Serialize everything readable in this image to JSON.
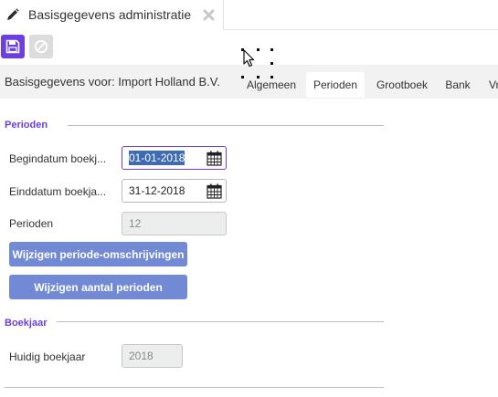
{
  "document_tab": {
    "title": "Basisgegevens administratie",
    "icon": "pencil-icon",
    "close_icon": "close-x-icon"
  },
  "toolbar": {
    "save_icon": "floppy-disk-icon",
    "cancel_icon": "cancel-circle-icon",
    "accent_color": "#6b3fe0"
  },
  "infobar": {
    "label": "Basisgegevens voor: Import Holland B.V."
  },
  "tabs": [
    {
      "label": "Algemeen",
      "active": false
    },
    {
      "label": "Perioden",
      "active": true
    },
    {
      "label": "Grootboek",
      "active": false
    },
    {
      "label": "Bank",
      "active": false
    },
    {
      "label": "Vr",
      "active": false
    }
  ],
  "sections": {
    "perioden": {
      "title": "Perioden",
      "begindatum_label": "Begindatum boekj...",
      "begindatum_value": "01-01-2018",
      "einddatum_label": "Einddatum boekja...",
      "einddatum_value": "31-12-2018",
      "perioden_label": "Perioden",
      "perioden_value": "12",
      "btn_omschrijvingen": "Wijzigen periode-omschrijvingen",
      "btn_aantal": "Wijzigen aantal perioden"
    },
    "boekjaar": {
      "title": "Boekjaar",
      "huidig_label": "Huidig boekjaar",
      "huidig_value": "2018"
    }
  }
}
